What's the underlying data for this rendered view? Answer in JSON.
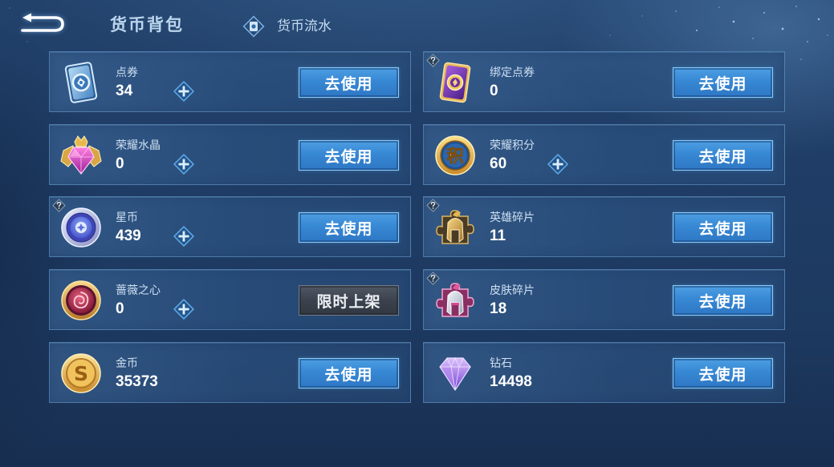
{
  "header": {
    "back_icon": "back-arrow-icon",
    "title": "货币背包",
    "tab": {
      "icon": "currency-ledger-icon",
      "label": "货币流水"
    }
  },
  "common": {
    "add_icon": "plus-icon",
    "help_icon": "question-mark-icon"
  },
  "colors": {
    "background": "#1f3d66",
    "card_background": "#2e5686",
    "card_border": "#6092c4",
    "action_button": "#3788d4",
    "action_button_border": "#8ccbf5",
    "disabled_button": "#3b424d",
    "title_text": "#bcd5ee",
    "label_text": "#cddff1",
    "value_text": "#ffffff"
  },
  "currencies": [
    {
      "label": "点券",
      "value": "34",
      "icon": "coupon-card-icon",
      "add_button": true,
      "help_badge": false,
      "action_label": "去使用",
      "action_enabled": true
    },
    {
      "label": "绑定点券",
      "value": "0",
      "icon": "bound-coupon-card-icon",
      "add_button": false,
      "help_badge": true,
      "action_label": "去使用",
      "action_enabled": true
    },
    {
      "label": "荣耀水晶",
      "value": "0",
      "icon": "glory-crystal-icon",
      "add_button": true,
      "help_badge": false,
      "action_label": "去使用",
      "action_enabled": true
    },
    {
      "label": "荣耀积分",
      "value": "60",
      "icon": "glory-points-icon",
      "icon_glyph": "积",
      "add_button": true,
      "help_badge": false,
      "action_label": "去使用",
      "action_enabled": true
    },
    {
      "label": "星币",
      "value": "439",
      "icon": "star-coin-icon",
      "add_button": true,
      "help_badge": true,
      "action_label": "去使用",
      "action_enabled": true
    },
    {
      "label": "英雄碎片",
      "value": "11",
      "icon": "hero-fragment-icon",
      "add_button": false,
      "help_badge": true,
      "action_label": "去使用",
      "action_enabled": true
    },
    {
      "label": "蔷薇之心",
      "value": "0",
      "icon": "rose-heart-icon",
      "add_button": true,
      "help_badge": false,
      "action_label": "限时上架",
      "action_enabled": false
    },
    {
      "label": "皮肤碎片",
      "value": "18",
      "icon": "skin-fragment-icon",
      "add_button": false,
      "help_badge": true,
      "action_label": "去使用",
      "action_enabled": true
    },
    {
      "label": "金币",
      "value": "35373",
      "icon": "gold-coin-icon",
      "icon_glyph": "S",
      "add_button": false,
      "help_badge": false,
      "action_label": "去使用",
      "action_enabled": true
    },
    {
      "label": "钻石",
      "value": "14498",
      "icon": "diamond-icon",
      "add_button": false,
      "help_badge": false,
      "action_label": "去使用",
      "action_enabled": true
    }
  ]
}
